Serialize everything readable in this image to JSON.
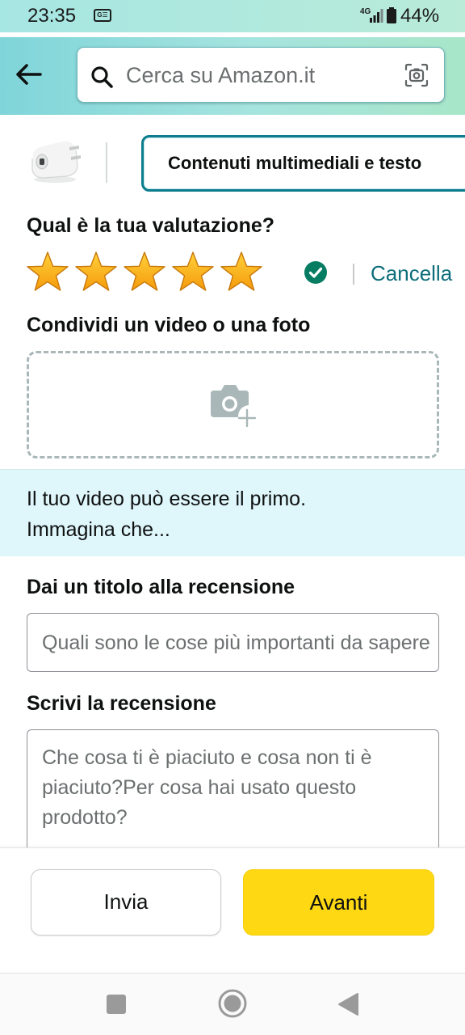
{
  "status_bar": {
    "time": "23:35",
    "sim_badge": "G☰",
    "network": "4G",
    "battery": "44%"
  },
  "header": {
    "back_icon": "arrow-left-icon",
    "search_placeholder": "Cerca su Amazon.it",
    "search_icon": "search-icon",
    "camera_icon": "camera-scan-icon"
  },
  "product": {
    "thumbnail": "usb-charger-image",
    "tab_label": "Contenuti multimediali e testo"
  },
  "rating": {
    "heading": "Qual è la tua valutazione?",
    "stars": 5,
    "max_stars": 5,
    "confirmed": true,
    "clear_label": "Cancella"
  },
  "media": {
    "heading": "Condividi un video o una foto",
    "upload_icon": "add-photo-icon"
  },
  "info": {
    "line1": "Il tuo video può essere il primo.",
    "line2": "Immagina che..."
  },
  "title_field": {
    "label": "Dai un titolo alla recensione",
    "placeholder": "Quali sono le cose più importanti da sapere?"
  },
  "review_field": {
    "label": "Scrivi la recensione",
    "placeholder": "Che cosa ti è piaciuto e cosa non ti è piaciuto?Per cosa hai usato questo prodotto?"
  },
  "actions": {
    "submit_label": "Invia",
    "next_label": "Avanti"
  },
  "colors": {
    "accent": "#0d7c8c",
    "star": "#ffa41c",
    "primary_button": "#ffd814",
    "info_bg": "#dff6fb"
  }
}
